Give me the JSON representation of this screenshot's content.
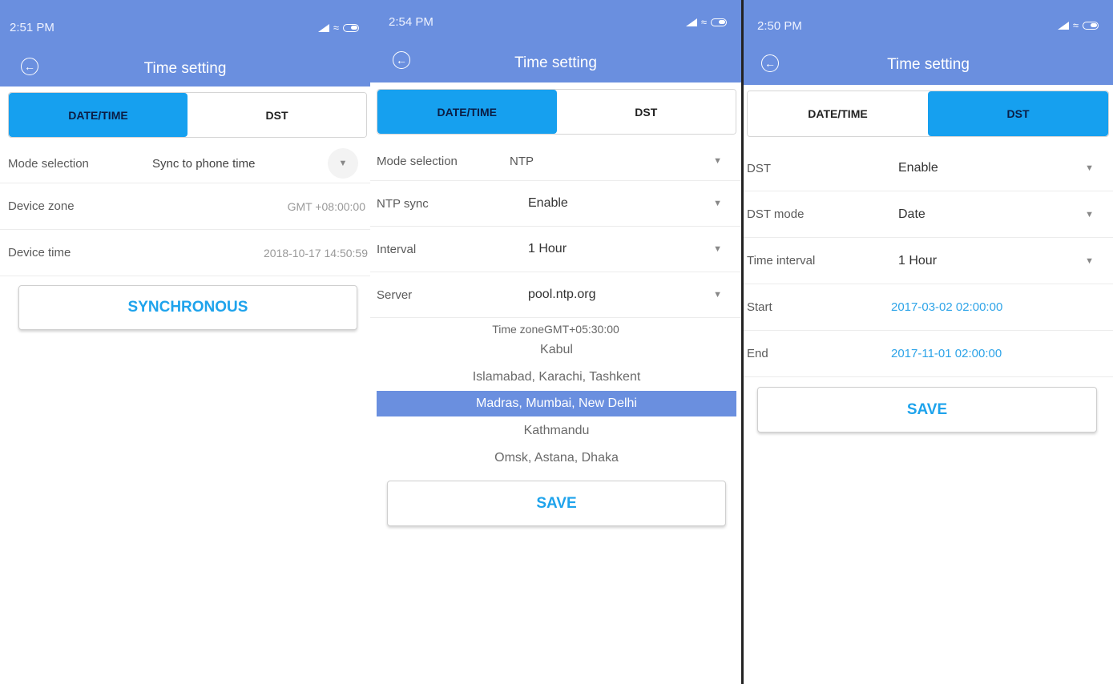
{
  "panel1": {
    "status_time": "2:51 PM",
    "title": "Time setting",
    "tabs": [
      "DATE/TIME",
      "DST"
    ],
    "rows": [
      {
        "label": "Mode selection",
        "value": "Sync to phone time"
      },
      {
        "label": "Device zone",
        "value": "GMT +08:00:00"
      },
      {
        "label": "Device time",
        "value": "2018-10-17 14:50:59"
      }
    ],
    "button": "SYNCHRONOUS"
  },
  "panel2": {
    "status_time": "2:54 PM",
    "title": "Time setting",
    "tabs": [
      "DATE/TIME",
      "DST"
    ],
    "rows": [
      {
        "label": "Mode selection",
        "value": "NTP"
      },
      {
        "label": "NTP sync",
        "value": "Enable"
      },
      {
        "label": "Interval",
        "value": "1 Hour"
      },
      {
        "label": "Server",
        "value": "pool.ntp.org"
      }
    ],
    "picker_header": "Time zoneGMT+05:30:00",
    "picker_items": [
      "Kabul",
      "Islamabad, Karachi, Tashkent",
      "Madras, Mumbai, New Delhi",
      "Kathmandu",
      "Omsk, Astana, Dhaka"
    ],
    "button": "SAVE"
  },
  "panel3": {
    "status_time": "2:50 PM",
    "title": "Time setting",
    "tabs": [
      "DATE/TIME",
      "DST"
    ],
    "rows": [
      {
        "label": "DST",
        "value": "Enable"
      },
      {
        "label": "DST mode",
        "value": "Date"
      },
      {
        "label": "Time interval",
        "value": "1 Hour"
      },
      {
        "label": "Start",
        "value": "2017-03-02 02:00:00"
      },
      {
        "label": "End",
        "value": "2017-11-01 02:00:00"
      }
    ],
    "button": "SAVE"
  },
  "colors": {
    "appbar": "#6a8fdf",
    "active_tab": "#16a0ef",
    "accent_text": "#1ea3ec"
  },
  "icons": [
    "back-arrow-icon",
    "signal-icon",
    "wifi-icon",
    "battery-icon",
    "dropdown-caret-icon"
  ]
}
